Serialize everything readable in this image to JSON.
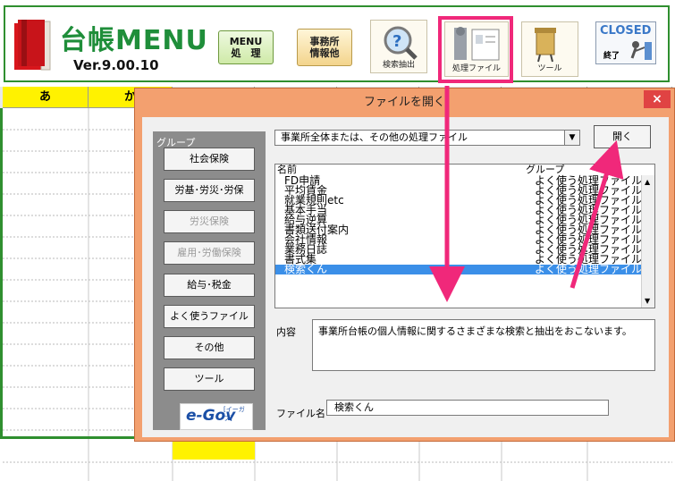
{
  "app": {
    "title": "台帳MENU",
    "version": "Ver.9.00.10"
  },
  "toolbar": {
    "menu_btn": "MENU\n処　理",
    "office_btn": "事務所\n情報他",
    "search_btn": "検索抽出",
    "process_btn": "処理ファイル",
    "tool_btn": "ツール",
    "closed_label": "CLOSED",
    "closed_sub": "終了"
  },
  "sheet": {
    "columns": [
      "あ",
      "か"
    ]
  },
  "dialog": {
    "title": "ファイルを開く",
    "close": "×",
    "group_caption": "グループ",
    "groups": [
      {
        "label": "社会保険",
        "enabled": true
      },
      {
        "label": "労基･労災･労保",
        "enabled": true
      },
      {
        "label": "労災保険",
        "enabled": false
      },
      {
        "label": "雇用･労働保険",
        "enabled": false
      },
      {
        "label": "給与･税金",
        "enabled": true
      },
      {
        "label": "よく使うファイル",
        "enabled": true
      },
      {
        "label": "その他",
        "enabled": true
      },
      {
        "label": "ツール",
        "enabled": true
      }
    ],
    "egov_text": "e-Gov",
    "egov_sub": "[イーガブ]",
    "category_value": "事業所全体または、その他の処理ファイル",
    "open_button": "開く",
    "list_header_name": "名前",
    "list_header_group": "グループ",
    "list_rows": [
      {
        "name": "FD申請",
        "group": "よく使う処理ファイル"
      },
      {
        "name": "平均賃金",
        "group": "よく使う処理ファイル"
      },
      {
        "name": "就業規則etc",
        "group": "よく使う処理ファイル"
      },
      {
        "name": "基本手当",
        "group": "よく使う処理ファイル"
      },
      {
        "name": "給与逆算",
        "group": "よく使う処理ファイル"
      },
      {
        "name": "書類送付案内",
        "group": "よく使う処理ファイル"
      },
      {
        "name": "会社情報",
        "group": "よく使う処理ファイル"
      },
      {
        "name": "業務日誌",
        "group": "よく使う処理ファイル"
      },
      {
        "name": "書式集",
        "group": "よく使う処理ファイル"
      },
      {
        "name": "検索くん",
        "group": "よく使う処理ファイル",
        "selected": true
      }
    ],
    "content_label": "内容",
    "content_text": "事業所台帳の個人情報に関するさまざまな検索と抽出をおこないます。",
    "filename_label": "ファイル名",
    "filename_value": "検索くん"
  },
  "colors": {
    "accent_green": "#2f8f2f",
    "highlight_pink": "#f0287a",
    "dialog_orange": "#f3a06f",
    "selection_blue": "#3b8fe8",
    "column_yellow": "#fff200"
  }
}
